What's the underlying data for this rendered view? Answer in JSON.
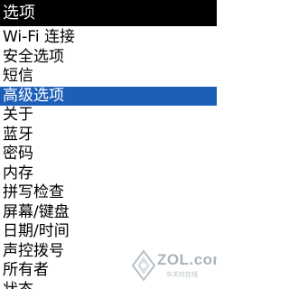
{
  "header": {
    "title": "选项"
  },
  "menu": {
    "selected_index": 3,
    "items": [
      {
        "label": "Wi-Fi 连接"
      },
      {
        "label": "安全选项"
      },
      {
        "label": "短信"
      },
      {
        "label": "高级选项"
      },
      {
        "label": "关于"
      },
      {
        "label": "蓝牙"
      },
      {
        "label": "密码"
      },
      {
        "label": "内存"
      },
      {
        "label": "拼写检查"
      },
      {
        "label": "屏幕/键盘"
      },
      {
        "label": "日期/时间"
      },
      {
        "label": "声控拨号"
      },
      {
        "label": "所有者"
      },
      {
        "label": "状态"
      }
    ]
  },
  "watermark": {
    "text": "ZOL.com.cn",
    "subtext": "中关村在线"
  },
  "colors": {
    "title_bg": "#000000",
    "selection": "#1c5fb8"
  }
}
